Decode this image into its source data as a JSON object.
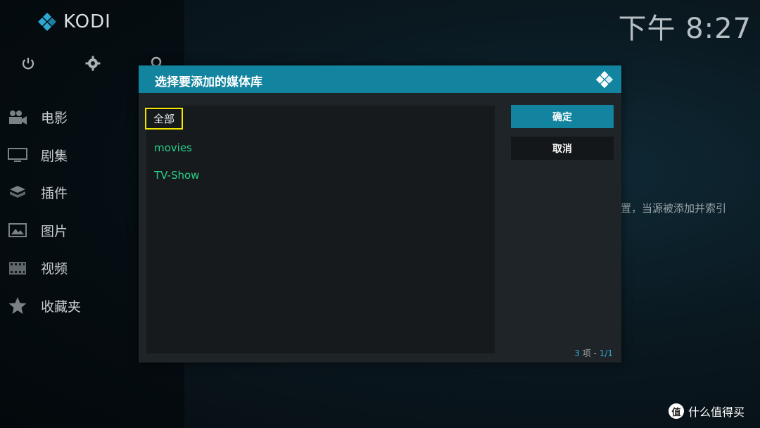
{
  "app": {
    "logo_text": "KODI"
  },
  "clock": "下午 8:27",
  "sidebar": {
    "top_icons": [
      "power-icon",
      "gear-icon",
      "search-icon"
    ],
    "items": [
      {
        "label": "电影",
        "icon": "movie-camera-icon"
      },
      {
        "label": "剧集",
        "icon": "tv-icon"
      },
      {
        "label": "插件",
        "icon": "addon-box-icon"
      },
      {
        "label": "图片",
        "icon": "picture-icon"
      },
      {
        "label": "视频",
        "icon": "film-strip-icon"
      },
      {
        "label": "收藏夹",
        "icon": "star-icon"
      }
    ]
  },
  "background_text": "置，当源被添加并索引",
  "dialog": {
    "title": "选择要添加的媒体库",
    "items": [
      {
        "label": "全部",
        "selected": true
      },
      {
        "label": "movies",
        "selected": false
      },
      {
        "label": "TV-Show",
        "selected": false
      }
    ],
    "ok_label": "确定",
    "cancel_label": "取消",
    "pager": {
      "count": "3",
      "unit": " 项 - ",
      "page": "1/1"
    }
  },
  "watermark": {
    "badge": "值",
    "text": "什么值得买"
  },
  "colors": {
    "accent": "#12849f",
    "selection_outline": "#f2e600",
    "item_green": "#2ad08a"
  }
}
